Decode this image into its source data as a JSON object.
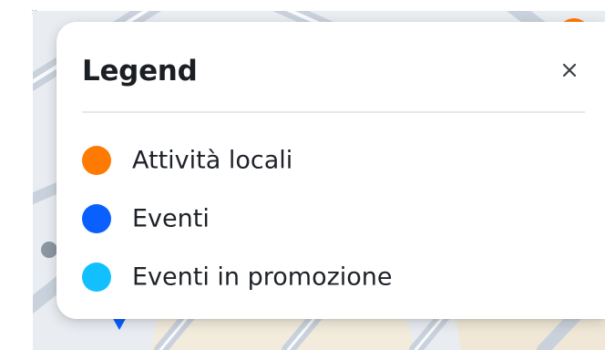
{
  "legend": {
    "title": "Legend",
    "close_icon": "close-icon",
    "items": [
      {
        "label": "Attività locali",
        "color": "#ff7a00"
      },
      {
        "label": "Eventi",
        "color": "#0a5fff"
      },
      {
        "label": "Eventi in promozione",
        "color": "#12c0ff"
      }
    ]
  },
  "map": {
    "icons": [
      "map-pin-icon",
      "map-marker-icon"
    ]
  },
  "colors": {
    "map_background": "#e9edf2",
    "road": "#c9d2dc",
    "panel": "#ffffff",
    "text": "#1e2228"
  }
}
